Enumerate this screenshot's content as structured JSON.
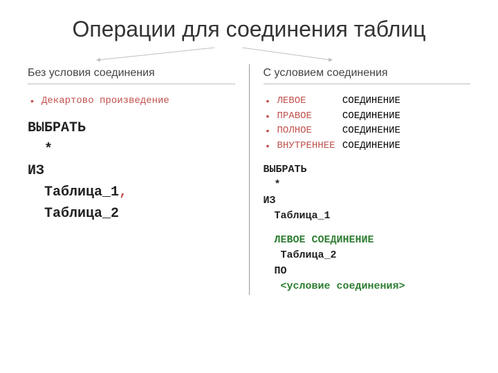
{
  "title": "Операции для соединения таблиц",
  "left": {
    "heading": "Без условия соединения",
    "bullet": "Декартово произведение",
    "code": [
      "ВЫБРАТЬ",
      "*",
      "ИЗ",
      "Таблица_1",
      ",",
      "Таблица_2"
    ]
  },
  "right": {
    "heading": "С условием соединения",
    "join_word": "СОЕДИНЕНИЕ",
    "join_types": [
      "ЛЕВОЕ",
      "ПРАВОЕ",
      "ПОЛНОЕ",
      "ВНУТРЕННЕЕ"
    ],
    "code": {
      "select": "ВЫБРАТЬ",
      "star": "*",
      "from": "ИЗ",
      "t1": "Таблица_1",
      "join_kw1": "ЛЕВОЕ",
      "join_kw2": "СОЕДИНЕНИЕ",
      "t2": "Таблица_2",
      "on": "ПО",
      "cond": "<условие соединения>"
    }
  },
  "colors": {
    "accent_red": "#c0504d",
    "accent_green": "#2e7d32"
  }
}
